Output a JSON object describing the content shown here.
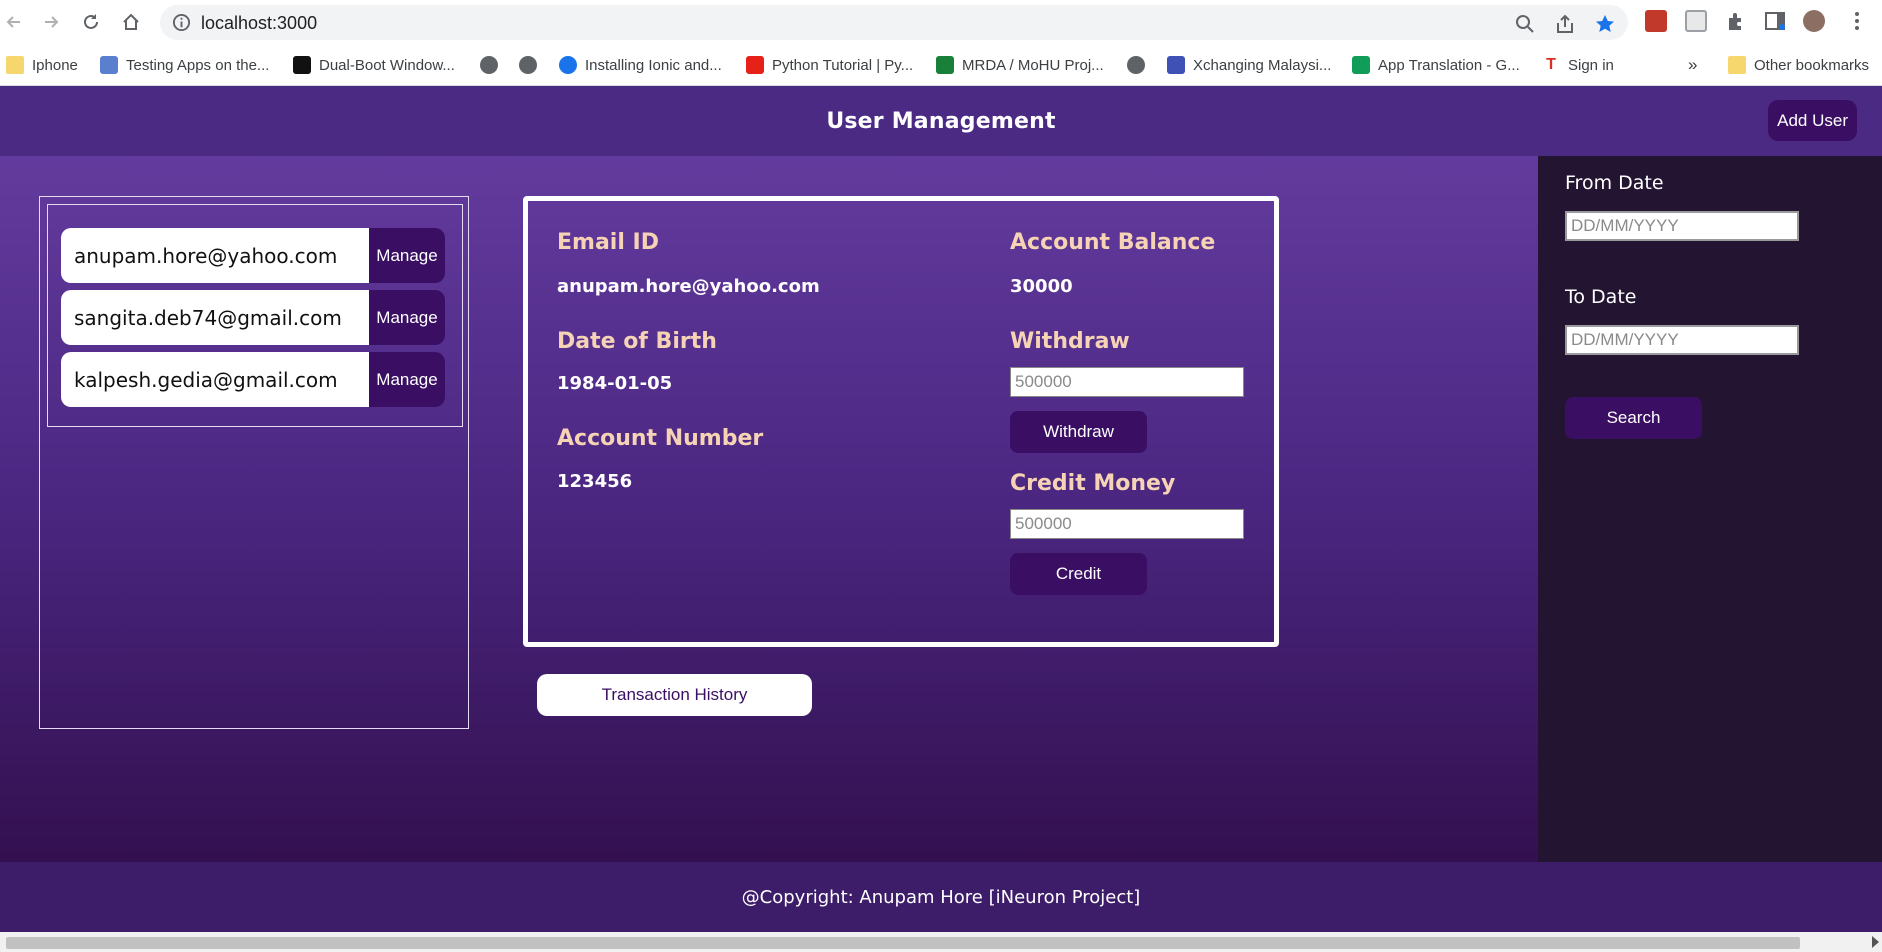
{
  "browser": {
    "url": "localhost:3000",
    "bookmarks": [
      {
        "label": "Iphone",
        "icon": "folder-icon"
      },
      {
        "label": "Testing Apps on the...",
        "icon": "grid-icon"
      },
      {
        "label": "Dual-Boot Window...",
        "icon": "site-icon"
      },
      {
        "label": "",
        "icon": "globe-icon"
      },
      {
        "label": "",
        "icon": "globe-icon"
      },
      {
        "label": "Installing Ionic and...",
        "icon": "ionic-icon"
      },
      {
        "label": "Python Tutorial | Py...",
        "icon": "youtube-icon"
      },
      {
        "label": "MRDA / MoHU Proj...",
        "icon": "sheets-icon"
      },
      {
        "label": "",
        "icon": "globe-icon"
      },
      {
        "label": "Xchanging Malaysi...",
        "icon": "site-icon"
      },
      {
        "label": "App Translation - G...",
        "icon": "plus-icon"
      },
      {
        "label": "Sign in",
        "icon": "t-icon"
      }
    ],
    "more_bookmarks": "»",
    "other_bookmarks": "Other bookmarks"
  },
  "header": {
    "title": "User Management",
    "add_user_label": "Add User"
  },
  "users": [
    {
      "email": "anupam.hore@yahoo.com",
      "action": "Manage"
    },
    {
      "email": "sangita.deb74@gmail.com",
      "action": "Manage"
    },
    {
      "email": "kalpesh.gedia@gmail.com",
      "action": "Manage"
    }
  ],
  "details": {
    "email_label": "Email ID",
    "email_value": "anupam.hore@yahoo.com",
    "dob_label": "Date of Birth",
    "dob_value": "1984-01-05",
    "account_number_label": "Account Number",
    "account_number_value": "123456",
    "balance_label": "Account Balance",
    "balance_value": "30000",
    "withdraw_label": "Withdraw",
    "withdraw_placeholder": "500000",
    "withdraw_button": "Withdraw",
    "credit_label": "Credit Money",
    "credit_placeholder": "500000",
    "credit_button": "Credit"
  },
  "transaction_history_label": "Transaction History",
  "filter": {
    "from_label": "From Date",
    "from_placeholder": "DD/MM/YYYY",
    "to_label": "To Date",
    "to_placeholder": "DD/MM/YYYY",
    "search_label": "Search"
  },
  "footer": {
    "text": "@Copyright: Anupam Hore [iNeuron Project]"
  },
  "colors": {
    "header_bg": "#4b2a84",
    "button_bg": "#3a0f63",
    "label_color": "#f6d3b4",
    "sidebar_bg": "#231431"
  }
}
